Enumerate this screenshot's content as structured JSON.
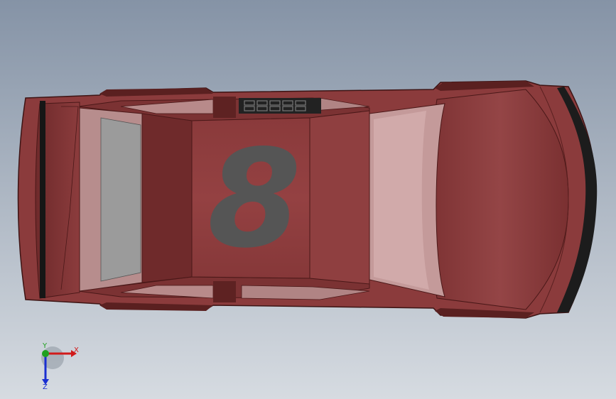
{
  "model": {
    "car_number": "8",
    "body_color": "#8e3e40",
    "body_dark": "#6f2828",
    "body_shadow": "#5a2020",
    "glass_color": "#c99a9a",
    "window_gray": "#9a9a9a",
    "number_color": "#555555",
    "tire_color": "#1a1a1a"
  },
  "triad": {
    "x_label": "X",
    "y_label": "Y",
    "z_label": "Z",
    "x_color": "#d11a1a",
    "y_color": "#1fa11f",
    "z_color": "#1a2fd1"
  }
}
